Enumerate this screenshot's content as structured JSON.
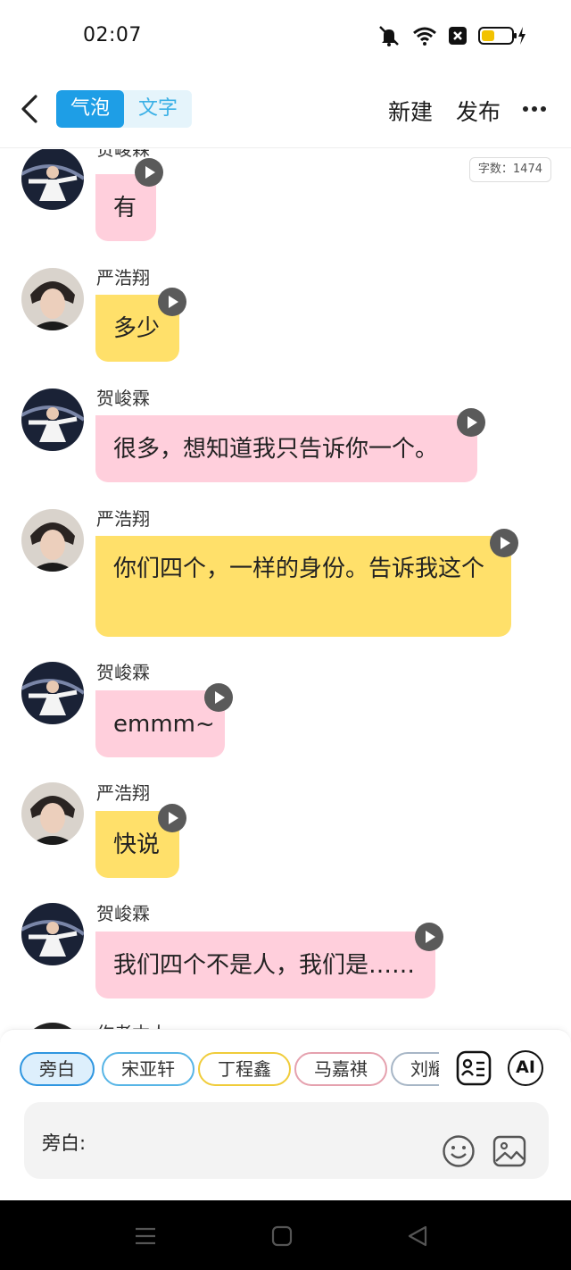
{
  "status_bar": {
    "time": "02:07"
  },
  "header": {
    "back_icon": "chevron-left-icon",
    "tabs": [
      {
        "label": "气泡",
        "active": true
      },
      {
        "label": "文字",
        "active": false
      }
    ],
    "new_label": "新建",
    "publish_label": "发布",
    "more_icon": "more-horizontal-icon"
  },
  "chat": {
    "word_count": "字数：1474",
    "messages": [
      {
        "name": "贺峻霖",
        "text": "有",
        "color": "pink"
      },
      {
        "name": "严浩翔",
        "text": "多少",
        "color": "yellow"
      },
      {
        "name": "贺峻霖",
        "text": "很多，想知道我只告诉你一个。",
        "color": "pink"
      },
      {
        "name": "严浩翔",
        "text": "你们四个，一样的身份。告诉我这个",
        "color": "yellow"
      },
      {
        "name": "贺峻霖",
        "text": "emmm~",
        "color": "pink"
      },
      {
        "name": "严浩翔",
        "text": "快说",
        "color": "yellow"
      },
      {
        "name": "贺峻霖",
        "text": "我们四个不是人，我们是……",
        "color": "pink"
      },
      {
        "name": "作者本人",
        "text": "",
        "color": "none"
      }
    ]
  },
  "bottom_panel": {
    "characters": [
      {
        "label": "旁白",
        "selected": true
      },
      {
        "label": "宋亚轩",
        "selected": false
      },
      {
        "label": "丁程鑫",
        "selected": false
      },
      {
        "label": "马嘉祺",
        "selected": false
      },
      {
        "label": "刘耀文",
        "selected": false
      }
    ],
    "ai_label": "AI",
    "input_label": "旁白:"
  },
  "colors": {
    "pink_bubble": "#ffcfdc",
    "yellow_bubble": "#ffe06a",
    "accent": "#1e9ee6"
  }
}
